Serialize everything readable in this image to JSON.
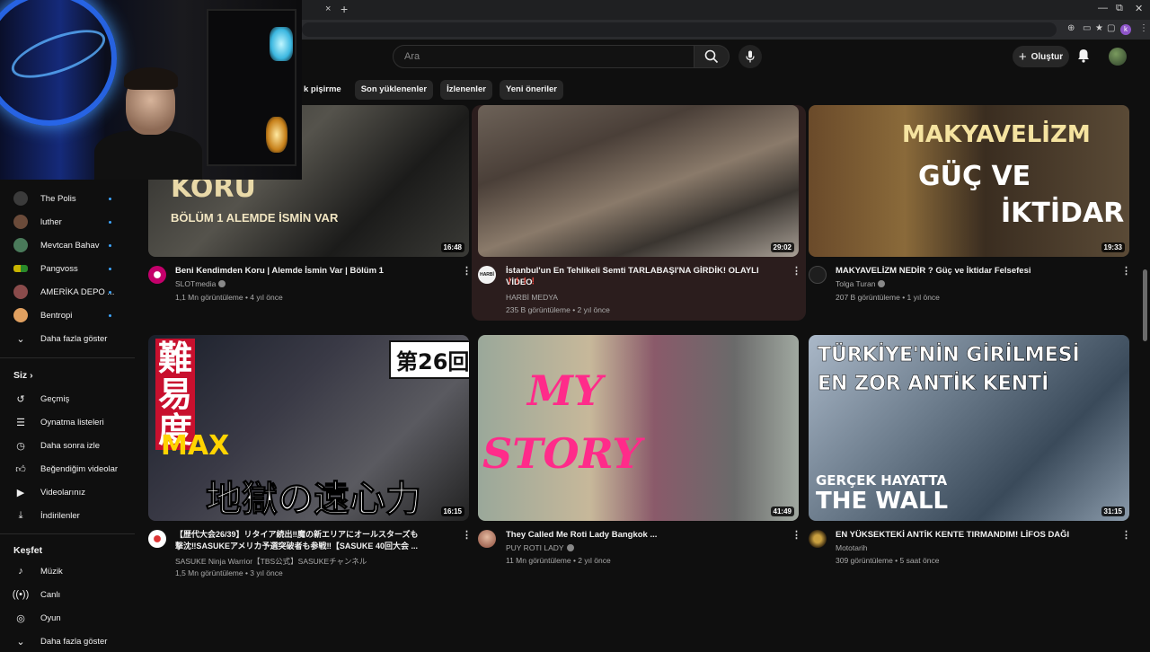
{
  "browser": {
    "tab_close": "×",
    "new_tab": "+"
  },
  "masthead": {
    "search_placeholder": "Ara",
    "create_label": "Oluştur"
  },
  "chips": [
    "k pişirme",
    "Son yüklenenler",
    "İzlenenler",
    "Yeni öneriler"
  ],
  "sidebar": {
    "subscriptions": [
      {
        "label": "The Polis",
        "color": "#3b3b3b"
      },
      {
        "label": "luther",
        "color": "#6b4b3a"
      },
      {
        "label": "Mevtcan Bahav",
        "color": "#4a7a5a"
      },
      {
        "label": "Pangvoss",
        "color": "#c8b400"
      },
      {
        "label": "AMERİKA DEPO ...",
        "color": "#8a4b4b"
      },
      {
        "label": "Bentropi",
        "color": "#e0a060"
      }
    ],
    "show_more": "Daha fazla göster",
    "you_header": "Siz",
    "you_items": [
      {
        "label": "Geçmiş",
        "icon": "history-icon"
      },
      {
        "label": "Oynatma listeleri",
        "icon": "playlist-icon"
      },
      {
        "label": "Daha sonra izle",
        "icon": "clock-icon"
      },
      {
        "label": "Beğendiğim videolar",
        "icon": "thumb-up-icon"
      },
      {
        "label": "Videolarınız",
        "icon": "your-videos-icon"
      },
      {
        "label": "İndirilenler",
        "icon": "download-icon"
      }
    ],
    "explore_header": "Keşfet",
    "explore_items": [
      {
        "label": "Müzik",
        "icon": "music-icon"
      },
      {
        "label": "Canlı",
        "icon": "live-icon"
      },
      {
        "label": "Oyun",
        "icon": "gaming-icon"
      }
    ],
    "show_more_2": "Daha fazla göster"
  },
  "videos": [
    {
      "title": "Beni Kendimden Koru | Alemde İsmin Var | Bölüm 1",
      "channel": "SLOTmedia",
      "meta": "1,1 Mn görüntüleme • 4 yıl önce",
      "duration": "16:48",
      "thumb_text": [
        "KORU",
        "BÖLÜM 1   ALEMDE İSMİN VAR"
      ]
    },
    {
      "title": "İstanbul'un En Tehlikeli Semti TARLABAŞI'NA GİRDİK! OLAYLI VİDEO",
      "subtitle": "❗❗❗❗",
      "channel": "HARBİ MEDYA",
      "meta": "235 B görüntüleme • 2 yıl önce",
      "duration": "29:02",
      "channel_badge": "HARBİ MEDYA"
    },
    {
      "title": "MAKYAVELİZM NEDİR ? Güç ve İktidar Felsefesi",
      "channel": "Tolga Turan",
      "meta": "207 B görüntüleme • 1 yıl önce",
      "duration": "19:33",
      "thumb_text": [
        "MAKYAVELİZM",
        "GÜÇ VE",
        "İKTİDAR"
      ]
    },
    {
      "title_line1": "【歴代大会26/39】リタイア続出‼魔の新エリアにオールスターズも",
      "title_line2": "撃沈‼SASUKEアメリカ予選突破者も参戦‼【SASUKE 40回大会 ...",
      "channel": "SASUKE Ninja Warrior【TBS公式】SASUKEチャンネル",
      "meta": "1,5 Mn görüntüleme • 3 yıl önce",
      "duration": "16:15",
      "thumb_text": [
        "難易度",
        "MAX",
        "第26回",
        "地獄の遠心力"
      ]
    },
    {
      "title": "They Called Me Roti Lady Bangkok ...",
      "channel": "PUY ROTI LADY",
      "meta": "11 Mn görüntüleme • 2 yıl önce",
      "duration": "41:49",
      "thumb_text": [
        "MY",
        "STORY"
      ]
    },
    {
      "title": "EN YÜKSEKTEKİ ANTİK KENTE TIRMANDIM! LİFOS DAĞI",
      "channel": "Mototarih",
      "meta": "309 görüntüleme • 5 saat önce",
      "duration": "31:15",
      "thumb_text": [
        "TÜRKİYE'NİN GİRİLMESİ",
        "EN ZOR ANTİK KENTİ",
        "GERÇEK HAYATTA",
        "THE WALL"
      ]
    }
  ]
}
